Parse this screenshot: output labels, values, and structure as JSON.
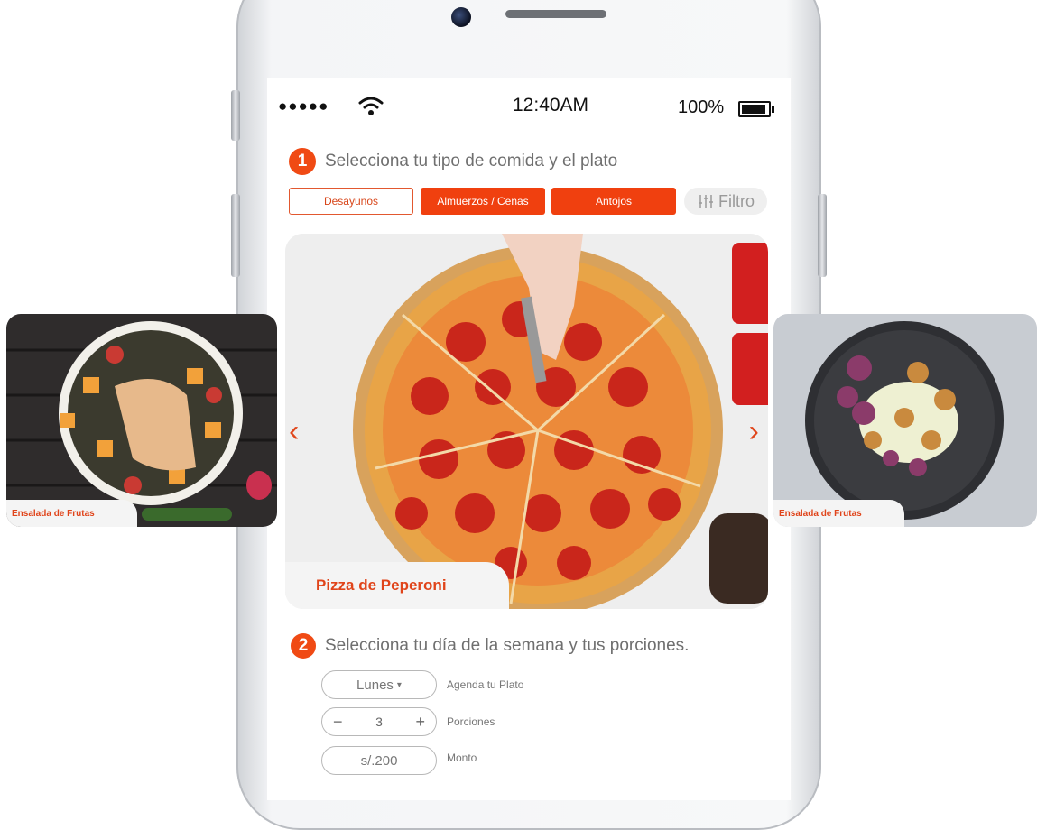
{
  "status_bar": {
    "signal": "●●●●●",
    "time": "12:40AM",
    "battery": "100%"
  },
  "step1": {
    "number": "1",
    "title": "Selecciona tu tipo de comida y el plato"
  },
  "tabs": [
    {
      "label": "Desayunos",
      "selected": false
    },
    {
      "label": "Almuerzos / Cenas",
      "selected": true
    },
    {
      "label": "Antojos",
      "selected": true
    }
  ],
  "filter": {
    "label": "Filtro",
    "icon": "sliders-icon"
  },
  "carousel": {
    "current_dish": "Pizza de Peperoni",
    "prev_icon": "chevron-left-icon",
    "next_icon": "chevron-right-icon"
  },
  "side_cards": [
    {
      "label": "Ensalada de Frutas"
    },
    {
      "label": "Ensalada de Frutas"
    }
  ],
  "step2": {
    "number": "2",
    "title": "Selecciona tu día de la semana y tus porciones."
  },
  "day": {
    "value": "Lunes",
    "label": "Agenda tu Plato"
  },
  "portions": {
    "minus": "−",
    "value": "3",
    "plus": "+",
    "label": "Porciones"
  },
  "amount": {
    "value": "s/.200",
    "label": "Monto"
  },
  "colors": {
    "accent": "#f0400f",
    "text_gray": "#6f6f6f"
  }
}
